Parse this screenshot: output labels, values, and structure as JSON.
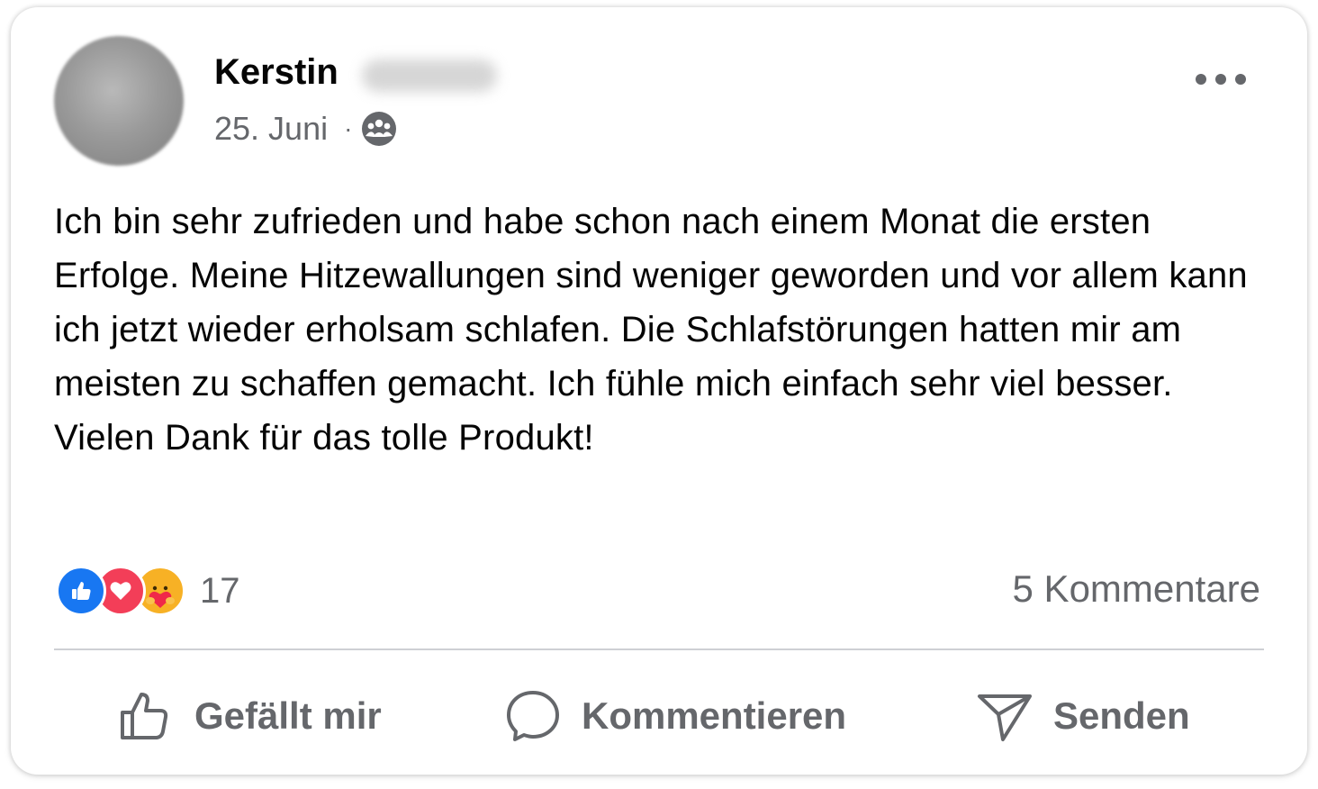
{
  "post": {
    "author_first_name": "Kerstin",
    "date": "25. Juni",
    "separator": "·",
    "audience_icon": "group-audience-icon",
    "more_icon": "more-options-icon",
    "text": "Ich bin sehr zufrieden und habe schon nach einem Monat die ersten Erfolge. Meine Hitzewallungen sind weniger geworden und vor allem kann ich jetzt wieder erholsam schlafen. Die Schlafstörungen hatten mir am meisten zu schaffen gemacht. Ich fühle mich einfach sehr viel besser. Vielen Dank für das tolle Produkt!"
  },
  "reactions": {
    "icons": [
      "like-reaction-icon",
      "love-reaction-icon",
      "care-reaction-icon"
    ],
    "count": "17",
    "comments": "5 Kommentare"
  },
  "actions": {
    "like_label": "Gefällt mir",
    "comment_label": "Kommentieren",
    "send_label": "Senden"
  },
  "colors": {
    "text_primary": "#050505",
    "text_secondary": "#65676b",
    "like_blue": "#1877f2",
    "love_red": "#f33e58",
    "care_yellow": "#f7b125",
    "divider": "#ced0d4"
  }
}
